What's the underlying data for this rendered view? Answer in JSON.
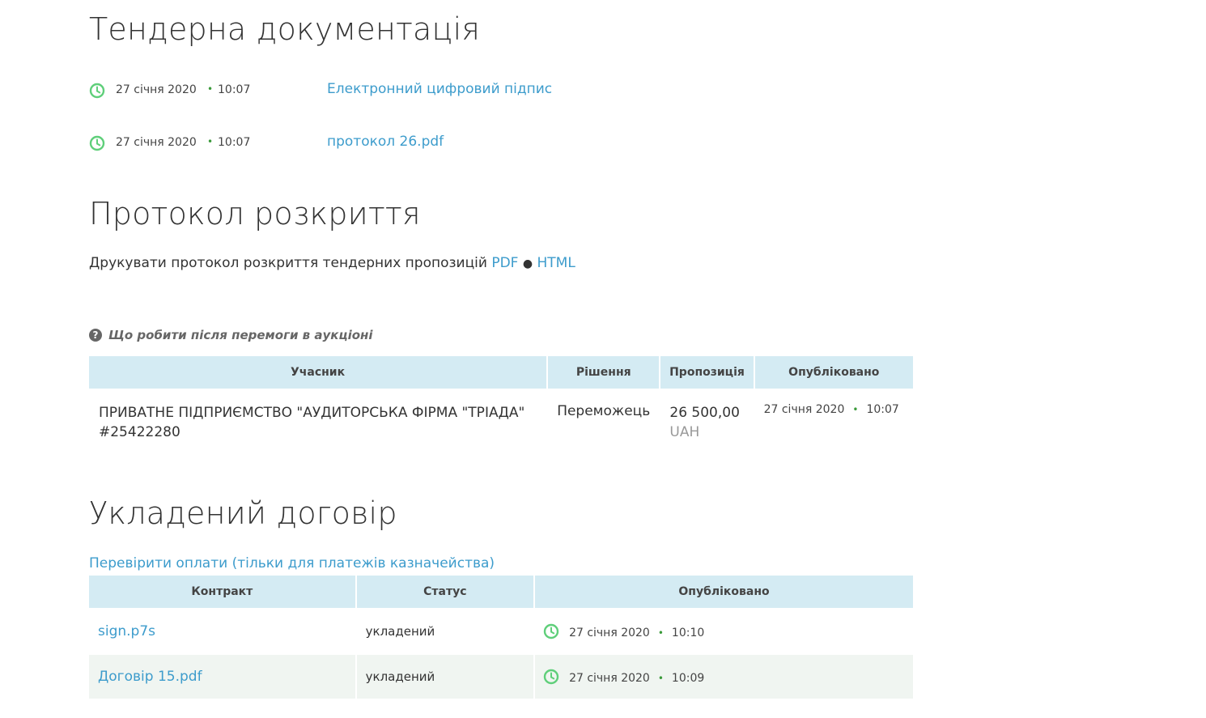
{
  "docs": {
    "title": "Тендерна документація",
    "items": [
      {
        "date": "27 січня 2020",
        "time": "10:07",
        "link": "Електронний цифровий підпис"
      },
      {
        "date": "27 січня 2020",
        "time": "10:07",
        "link": "протокол 26.pdf"
      }
    ]
  },
  "protocol": {
    "title": "Протокол розкриття",
    "print_text": "Друкувати протокол розкриття тендерних пропозицій",
    "pdf": "PDF",
    "sep": "●",
    "html": "HTML"
  },
  "faq": {
    "text": "Що робити після перемоги в аукціоні",
    "icon": "question-circle-icon"
  },
  "bids": {
    "headers": [
      "Учасник",
      "Рішення",
      "Пропозиція",
      "Опубліковано"
    ],
    "rows": [
      {
        "participant": "ПРИВАТНЕ ПІДПРИЄМСТВО \"АУДИТОРСЬКА ФІРМА \"ТРІАДА\"",
        "code": "#25422280",
        "decision": "Переможець",
        "amount": "26 500,00",
        "currency": "UAH",
        "date": "27 січня 2020",
        "time": "10:07"
      }
    ]
  },
  "contract": {
    "title": "Укладений договір",
    "check_link": "Перевірити оплати (тільки для платежів казначейства)",
    "headers": [
      "Контракт",
      "Статус",
      "Опубліковано"
    ],
    "rows": [
      {
        "file": "sign.p7s",
        "status": "укладений",
        "date": "27 січня 2020",
        "time": "10:10"
      },
      {
        "file": "Договір 15.pdf",
        "status": "укладений",
        "date": "27 січня 2020",
        "time": "10:09"
      }
    ]
  },
  "colors": {
    "link": "#3d9ccc",
    "header_bg": "#d4ebf3",
    "row_alt_bg": "#f0f5f1",
    "clock": "#5fcf7a"
  }
}
